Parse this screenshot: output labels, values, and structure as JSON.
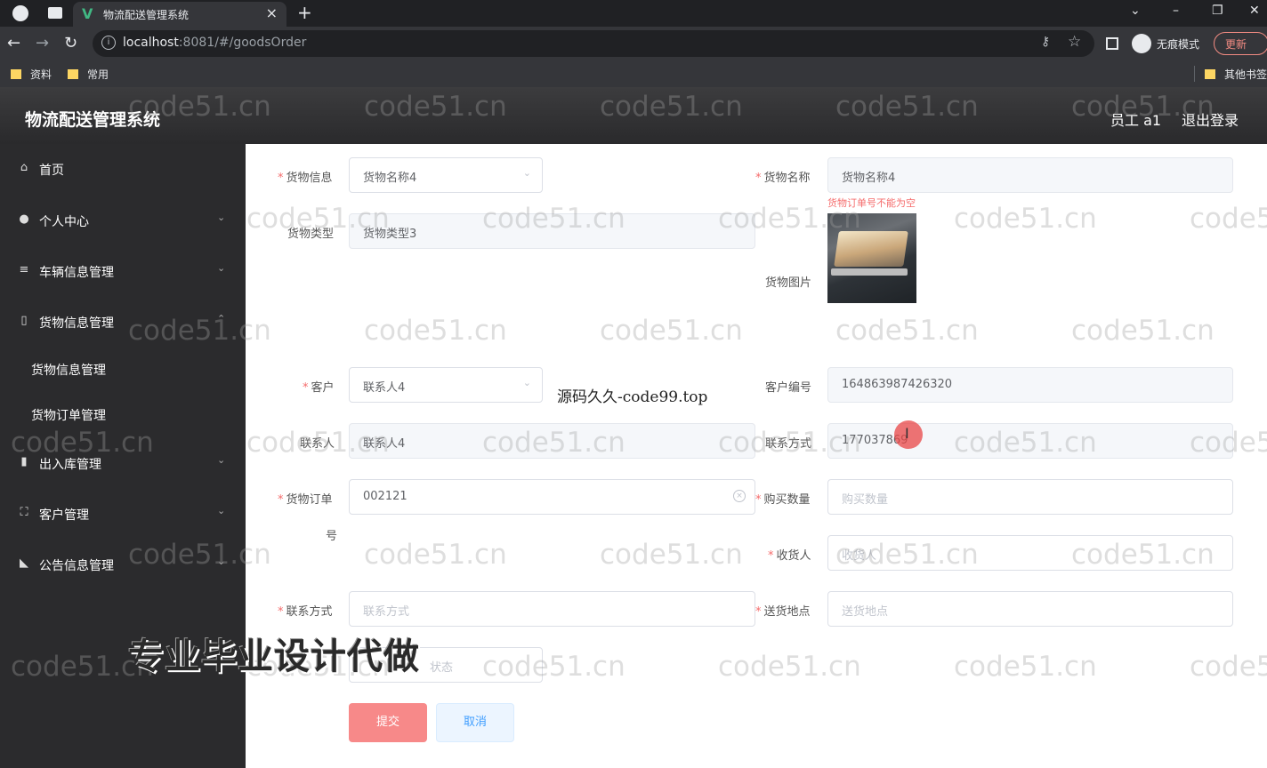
{
  "browser": {
    "tab_title": "物流配送管理系统",
    "tab_logo": "V",
    "url_host": "localhost",
    "url_rest": ":8081/#/goodsOrder",
    "incognito_label": "无痕模式",
    "update_label": "更新",
    "bookmarks": [
      "资料",
      "常用"
    ],
    "other_bookmarks": "其他书签"
  },
  "header": {
    "title": "物流配送管理系统",
    "user": "员工 a1",
    "logout": "退出登录"
  },
  "sidebar": {
    "items": [
      {
        "label": "首页",
        "icon": "home-icon"
      },
      {
        "label": "个人中心",
        "icon": "user-icon"
      },
      {
        "label": "车辆信息管理",
        "icon": "sliders-icon"
      },
      {
        "label": "货物信息管理",
        "icon": "phone-icon"
      },
      {
        "label": "货物信息管理"
      },
      {
        "label": "货物订单管理"
      },
      {
        "label": "出入库管理",
        "icon": "chart-icon"
      },
      {
        "label": "客户管理",
        "icon": "frame-icon"
      },
      {
        "label": "公告信息管理",
        "icon": "megaphone-icon"
      }
    ]
  },
  "form": {
    "goods_info": {
      "label": "货物信息",
      "value": "货物名称4"
    },
    "goods_name": {
      "label": "货物名称",
      "value": "货物名称4"
    },
    "goods_name_error": "货物订单号不能为空",
    "goods_type": {
      "label": "货物类型",
      "value": "货物类型3"
    },
    "goods_image": {
      "label": "货物图片"
    },
    "customer": {
      "label": "客户",
      "value": "联系人4"
    },
    "customer_no": {
      "label": "客户编号",
      "value": "164863987426320"
    },
    "contact": {
      "label": "联系人",
      "value": "联系人4"
    },
    "contact_phone": {
      "label": "联系方式",
      "value": "177037869"
    },
    "order_no": {
      "label_line1": "货物订单",
      "label_line2": "号",
      "value": "002121"
    },
    "quantity": {
      "label": "购买数量",
      "placeholder": "购买数量"
    },
    "receiver": {
      "label": "收货人",
      "placeholder": "收货人"
    },
    "receiver_phone": {
      "label": "联系方式",
      "placeholder": "联系方式"
    },
    "delivery_addr": {
      "label": "送货地点",
      "placeholder": "送货地点"
    },
    "status": {
      "placeholder": "状态"
    },
    "submit": "提交",
    "cancel": "取消"
  },
  "overlay": {
    "ad": "源码久久-code99.top",
    "promo": "专业毕业设计代做",
    "watermark": "code51.cn"
  },
  "colors": {
    "sidebar_bg": "#2b2b2d",
    "submit_bg": "#f78989",
    "required_mark": "#f56c6c"
  }
}
